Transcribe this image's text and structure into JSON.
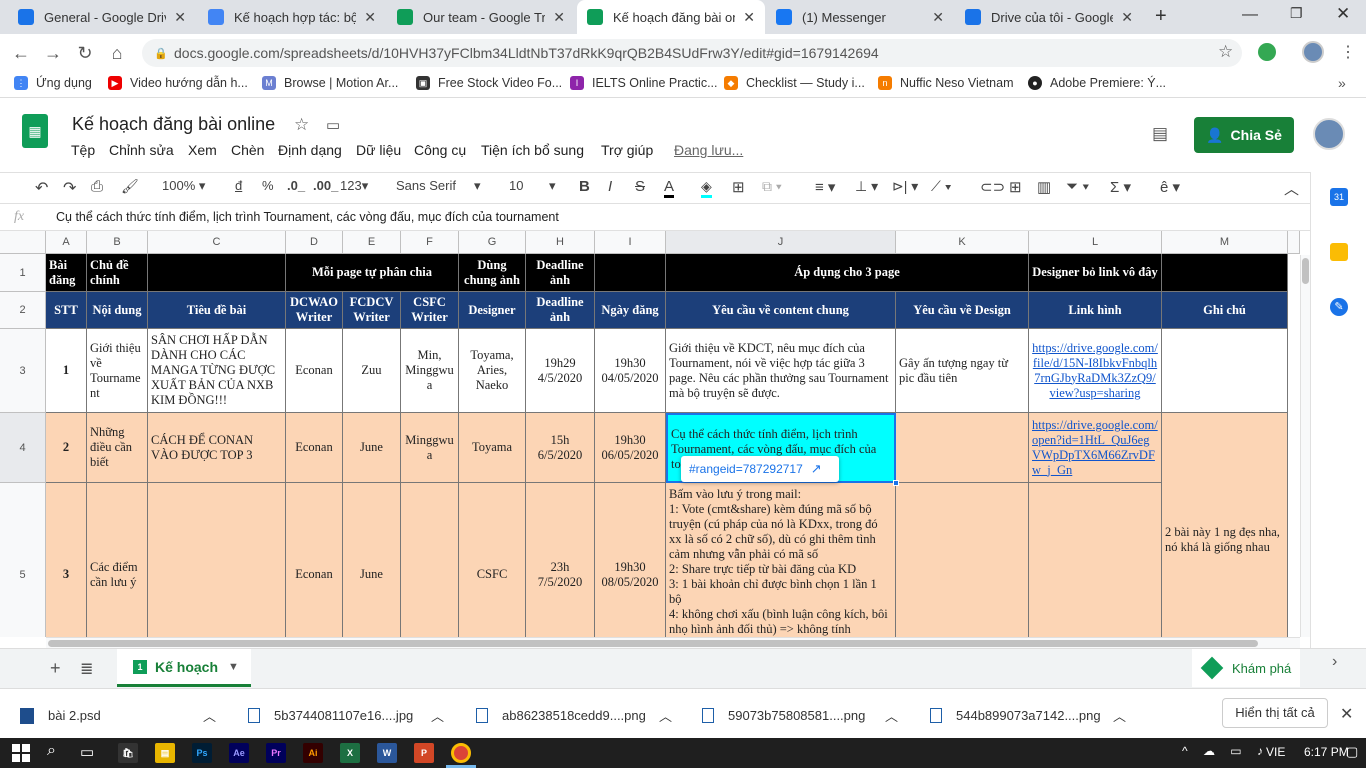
{
  "tabs": [
    {
      "label": "General - Google Drive",
      "color": "#1a73e8",
      "icon": "drive-icon"
    },
    {
      "label": "Kế hoạch hợp tác: bộ b",
      "color": "#4285f4",
      "icon": "docs-icon"
    },
    {
      "label": "Our team - Google Tran",
      "color": "#0f9d58",
      "icon": "sheets-icon"
    },
    {
      "label": "Kế hoạch đăng bài onlin",
      "color": "#0f9d58",
      "icon": "sheets-icon"
    },
    {
      "label": "(1) Messenger",
      "color": "#1877f2",
      "icon": "facebook-icon"
    },
    {
      "label": "Drive của tôi - Google D",
      "color": "#1a73e8",
      "icon": "drive-icon"
    }
  ],
  "url": "docs.google.com/spreadsheets/d/10HVH37yFClbm34LldtNbT37dRkK9qrQB2B4SUdFrw3Y/edit#gid=1679142694",
  "bookmarks": [
    "Ứng dụng",
    "Video hướng dẫn h...",
    "Browse | Motion Ar...",
    "Free Stock Video Fo...",
    "IELTS Online Practic...",
    "Checklist — Study i...",
    "Nuffic Neso Vietnam",
    "Adobe Premiere: Ý..."
  ],
  "doc_title": "Kế hoạch đăng bài online",
  "menu": [
    "Tệp",
    "Chỉnh sửa",
    "Xem",
    "Chèn",
    "Định dạng",
    "Dữ liệu",
    "Công cụ",
    "Tiện ích bổ sung",
    "Trợ giúp",
    "Đang lưu..."
  ],
  "share_label": "Chia Sẻ",
  "toolbar": {
    "zoom": "100%",
    "currency": "đ",
    "percent": "%",
    "dec0": ".0_",
    "dec1": ".00_",
    "fmt": "123▾",
    "font": "Sans Serif",
    "size": "10"
  },
  "formula": {
    "fx": "fx",
    "content": "Cụ thể cách thức tính điểm, lịch trình Tournament, các vòng đấu, mục đích của tournament"
  },
  "columns": [
    "A",
    "B",
    "C",
    "D",
    "E",
    "F",
    "G",
    "H",
    "I",
    "J",
    "K",
    "L",
    "M"
  ],
  "rows": [
    "1",
    "2",
    "3",
    "4",
    "5"
  ],
  "row1": {
    "a": "Bài đăng",
    "b": "Chủ đề chính",
    "def": "Mỗi page tự phân chia",
    "g": "Dùng chung ảnh",
    "h": "Deadline ảnh",
    "jk": "Áp dụng cho 3 page",
    "l": "Designer bỏ link vô đây"
  },
  "row2": {
    "a": "STT",
    "b": "Nội dung",
    "c": "Tiêu đề bài",
    "d": "DCWAO Writer",
    "e": "FCDCV Writer",
    "f": "CSFC Writer",
    "g": "Designer",
    "h": "Deadline ảnh",
    "i": "Ngày đăng",
    "j": "Yêu cầu về content chung",
    "k": "Yêu cầu về Design",
    "l": "Link hình",
    "m": "Ghi chú"
  },
  "row3": {
    "a": "1",
    "b": "Giới thiệu về Tourname nt",
    "c": "SÂN CHƠI HẤP DẪN DÀNH CHO CÁC MANGA TỪNG ĐƯỢC XUẤT BẢN CỦA NXB KIM ĐỒNG!!!",
    "d": "Econan",
    "e": "Zuu",
    "f": "Min, Minggwu a",
    "g": "Toyama, Aries, Naeko",
    "h": "19h29 4/5/2020",
    "i": "19h30 04/05/2020",
    "j": "Giới thiệu về KDCT, nêu mục đích của Tournament, nói về việc hợp tác giữa 3 page. Nêu các phần thưởng sau Tournament mà bộ truyện sẽ được.",
    "k": "Gây ấn tượng ngay từ pic đầu tiên",
    "l": "https://drive.google.com/file/d/15N-I8IbkvFnbqlh7rnGJbyRaDMk3ZzQ9/view?usp=sharing"
  },
  "row4": {
    "a": "2",
    "b": "Những điều cần biết",
    "c": "CÁCH ĐỂ CONAN VÀO ĐƯỢC TOP 3",
    "d": "Econan",
    "e": "June",
    "f": "Minggwu a",
    "g": "Toyama",
    "h": "15h 6/5/2020",
    "i": "19h30 06/05/2020",
    "j": "Cụ thể cách thức tính điểm, lịch trình Tournament, các vòng đấu, mục đích của tournament",
    "l": "https://drive.google.com/open?id=1HtL_QuJ6egVWpDpTX6M66ZrvDFw_j_Gn"
  },
  "row5": {
    "a": "3",
    "b": "Các điểm cần lưu ý",
    "d": "Econan",
    "e": "June",
    "g": "CSFC",
    "h": "23h 7/5/2020",
    "i": "19h30 08/05/2020",
    "j": "Bấm vào lưu ý trong mail:\n1: Vote (cmt&share) kèm đúng mã số bộ truyện (cú pháp của nó là KDxx, trong đó xx là số có 2 chữ số), dù có ghi thêm tình cảm nhưng vẫn phải có mã số\n2: Share trực tiếp từ bài đăng của KD\n3: 1 bài khoản chỉ được bình chọn 1 lần 1 bộ\n4: không chơi xấu (bình luận công kích, bôi nhọ hình ảnh đối thủ) => không tính",
    "m": "2 bài này 1 ng đẹs nha, nó khá là giống nhau"
  },
  "rangeid": "#rangeid=787292717",
  "sheet_tab": "Kế hoạch",
  "explore": "Khám phá",
  "downloads": [
    "bài 2.psd",
    "5b3744081107e16....jpg",
    "ab86238518cedd9....png",
    "59073b75808581....png",
    "544b899073a7142....png"
  ],
  "show_all": "Hiển thị tất cả",
  "taskbar": {
    "lang": "VIE",
    "time": "6:17 PM"
  }
}
